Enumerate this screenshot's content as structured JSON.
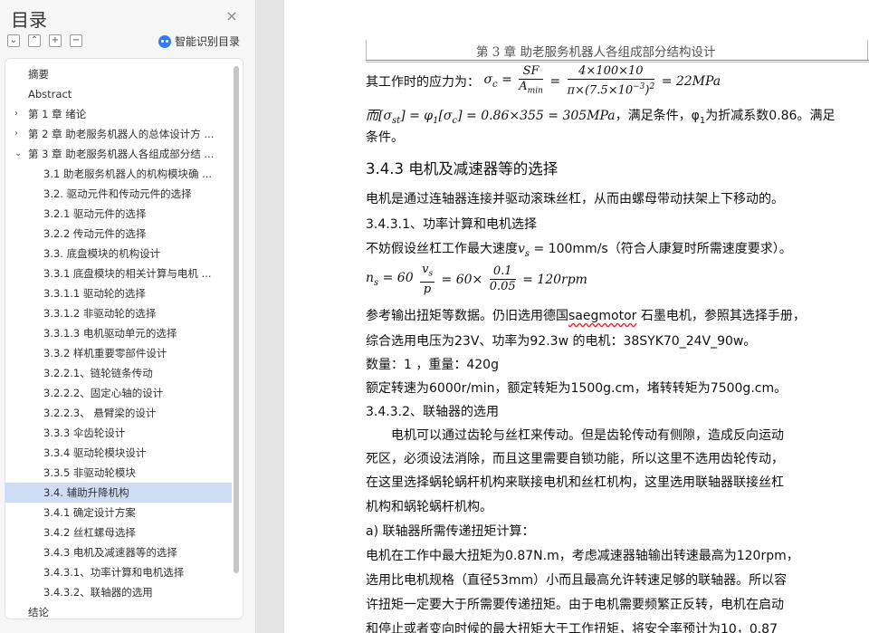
{
  "nav": {
    "title": "目录",
    "close_icon": "×",
    "tools": [
      "⌄",
      "⌃",
      "+",
      "−"
    ],
    "smart_toc_label": "智能识别目录",
    "toc": [
      {
        "label": "摘要",
        "level": 1
      },
      {
        "label": "Abstract",
        "level": 1
      },
      {
        "label": "第 1 章  绪论",
        "level": 1,
        "arrow": "›"
      },
      {
        "label": "第 2 章  助老服务机器人的总体设计方 ...",
        "level": 1,
        "arrow": "›"
      },
      {
        "label": "第 3 章  助老服务机器人各组成部分结 ...",
        "level": 1,
        "arrow": "⌄"
      },
      {
        "label": "3.1 助老服务机器人的机构模块确 ...",
        "level": 2
      },
      {
        "label": "3.2.  驱动元件和传动元件的选择",
        "level": 2
      },
      {
        "label": "3.2.1  驱动元件的选择",
        "level": 2
      },
      {
        "label": "3.2.2  传动元件的选择",
        "level": 2
      },
      {
        "label": "3.3.  底盘模块的机构设计",
        "level": 2
      },
      {
        "label": "3.3.1  底盘模块的相关计算与电机 ...",
        "level": 2
      },
      {
        "label": "3.3.1.1  驱动轮的选择",
        "level": 2
      },
      {
        "label": "3.3.1.2  非驱动轮的选择",
        "level": 2
      },
      {
        "label": "3.3.1.3  电机驱动单元的选择",
        "level": 2
      },
      {
        "label": "3.3.2  样机重要零部件设计",
        "level": 2
      },
      {
        "label": "3.2.2.1、链轮链条传动",
        "level": 2
      },
      {
        "label": "3.2.2.2、固定心轴的设计",
        "level": 2
      },
      {
        "label": "3.2.2.3、  悬臂梁的设计",
        "level": 2
      },
      {
        "label": "3.3.3  伞齿轮设计",
        "level": 2
      },
      {
        "label": "3.3.4  驱动轮模块设计",
        "level": 2
      },
      {
        "label": "3.3.5  非驱动轮模块",
        "level": 2
      },
      {
        "label": "3.4.  辅助升降机构",
        "level": 2,
        "active": true
      },
      {
        "label": "3.4.1  确定设计方案",
        "level": 2
      },
      {
        "label": "3.4.2  丝杠螺母选择",
        "level": 2
      },
      {
        "label": "3.4.3  电机及减速器等的选择",
        "level": 2
      },
      {
        "label": "3.4.3.1、功率计算和电机选择",
        "level": 2
      },
      {
        "label": "3.4.3.2、联轴器的选用",
        "level": 2
      },
      {
        "label": "结论",
        "level": 1
      }
    ]
  },
  "doc": {
    "header": "第 3 章  助老服务机器人各组成部分结构设计",
    "l1_prefix": "其工作时的应力为：",
    "l1_sigma": "σ",
    "l1_sub_c": "c",
    "l1_f1_num": "SF",
    "l1_f1_den": "A",
    "l1_f1_den_sub": "min",
    "l1_f2_num": "4×100×10",
    "l1_f2_den": "π×(7.5×10",
    "l1_f2_den_exp": "−3",
    "l1_f2_den_tail": ")",
    "l1_f2_den_exp2": "2",
    "l1_result": "= 22MPa",
    "l2_text": "而[σ",
    "l2_sub_st": "st",
    "l2_mid": "] = φ",
    "l2_sub_1": "1",
    "l2_mid2": "[σ",
    "l2_sub_c": "c",
    "l2_eq": "] = 0.86×355 = 305MPa",
    "l2_tail": "，满足条件，φ",
    "l2_tail_sub": "1",
    "l2_tail2": "为折减系数0.86。满足",
    "l3_text": "条件。",
    "h_343": "3.4.3  电机及减速器等的选择",
    "p1": "电机是通过连轴器连接并驱动滚珠丝杠，从而由螺母带动扶架上下移动的。",
    "h_3431": "3.4.3.1、功率计算和电机选择",
    "p2_a": "不妨假设丝杠工作最大速度",
    "p2_v": "v",
    "p2_vsub": "s",
    "p2_b": " = 100mm/s（符合人康复时所需速度要求）。",
    "eq_n": "n",
    "eq_nsub": "s",
    "eq_a": " = 60",
    "eq_f1_num": "v",
    "eq_f1_num_sub": "s",
    "eq_f1_den": "p",
    "eq_b": "= 60×",
    "eq_f2_num": "0.1",
    "eq_f2_den": "0.05",
    "eq_c": "= 120rpm",
    "p3_a": "参考输出扭矩等数据。仍旧选用德国",
    "p3_brand": "saegmotor",
    "p3_b": " 石墨电机，参照其选择手册，",
    "p4": "综合选用电压为23V、功率为92.3w 的电机：38SYK70_24V_90w。",
    "p5": "数量：1  ，重量：420g",
    "p6": "额定转速为6000r/min，额定转矩为1500g.cm，堵转转矩为7500g.cm。",
    "h_3432": "3.4.3.2、联轴器的选用",
    "p7": "电机可以通过齿轮与丝杠来传动。但是齿轮传动有侧隙，造成反向运动",
    "p8": "死区，必须设法消除，而且这里需要自锁功能，所以这里不选用齿轮传动，",
    "p9": "在这里选择蜗轮蜗杆机构来联接电机和丝杠机构，这里选用联轴器联接丝杠",
    "p10": "机构和蜗轮蜗杆机构。",
    "p11": "a) 联轴器所需传递扭矩计算：",
    "p12": "电机在工作中最大扭矩为0.87N.m，考虑减速器轴输出转速最高为120rpm，",
    "p13": "选用比电机规格（直径53mm）小而且最高允许转速足够的联轴器。所以容",
    "p14": "许扭矩一定要大于所需要传递扭矩。由于电机需要频繁正反转，电机在启动",
    "p15": "和停止或者变向时候的最大扭矩大于工作扭矩，将安全率预计为10，0.87"
  }
}
